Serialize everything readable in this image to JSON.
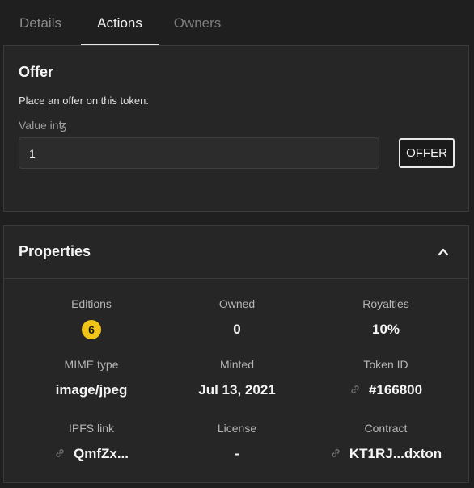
{
  "tabs": [
    {
      "label": "Details"
    },
    {
      "label": "Actions"
    },
    {
      "label": "Owners"
    }
  ],
  "offer": {
    "title": "Offer",
    "description": "Place an offer on this token.",
    "value_label": "Value inꜩ",
    "value": "1",
    "button_label": "OFFER"
  },
  "properties": {
    "title": "Properties",
    "items": [
      {
        "label": "Editions",
        "value": "6"
      },
      {
        "label": "Owned",
        "value": "0"
      },
      {
        "label": "Royalties",
        "value": "10%"
      },
      {
        "label": "MIME type",
        "value": "image/jpeg"
      },
      {
        "label": "Minted",
        "value": "Jul 13, 2021"
      },
      {
        "label": "Token ID",
        "value": "#166800"
      },
      {
        "label": "IPFS link",
        "value": "QmfZx..."
      },
      {
        "label": "License",
        "value": "-"
      },
      {
        "label": "Contract",
        "value": "KT1RJ...dxton"
      }
    ]
  },
  "colors": {
    "background": "#1f1f1f",
    "card": "#262626",
    "badge": "#f0c419",
    "active_tab": "#f2f2f2",
    "inactive_tab": "#8a8a8a"
  },
  "icons": {
    "chevron": "chevron-up-icon",
    "link": "link-icon"
  }
}
